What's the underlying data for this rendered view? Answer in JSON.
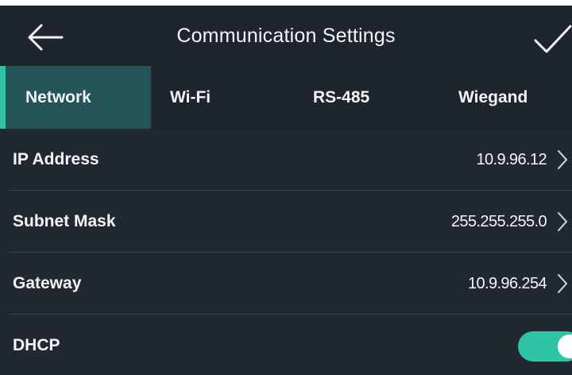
{
  "header": {
    "title": "Communication Settings",
    "back_icon": "arrow-left-icon",
    "confirm_icon": "checkmark-icon"
  },
  "tabs": [
    {
      "label": "Network",
      "active": true
    },
    {
      "label": "Wi-Fi",
      "active": false
    },
    {
      "label": "RS-485",
      "active": false
    },
    {
      "label": "Wiegand",
      "active": false
    }
  ],
  "settings": {
    "ip_address": {
      "label": "IP Address",
      "value": "10.9.96.12"
    },
    "subnet_mask": {
      "label": "Subnet Mask",
      "value": "255.255.255.0"
    },
    "gateway": {
      "label": "Gateway",
      "value": "10.9.96.254"
    },
    "dhcp": {
      "label": "DHCP",
      "enabled": true
    }
  },
  "colors": {
    "background": "#1f252d",
    "active_tab": "#255458",
    "accent": "#2ec4a8"
  }
}
